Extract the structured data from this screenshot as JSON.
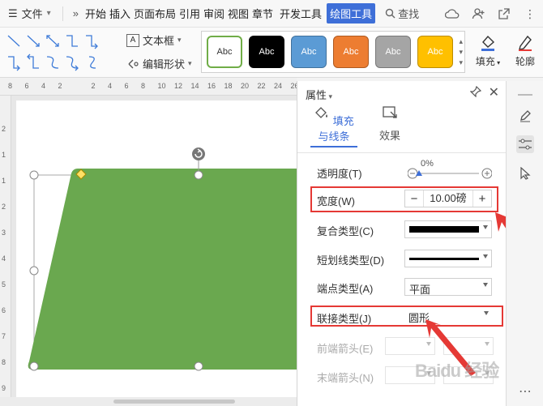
{
  "menubar": {
    "file_label": "文件",
    "tabs": [
      "开始",
      "插入",
      "页面布局",
      "引用",
      "审阅",
      "视图",
      "章节",
      "开发工具",
      "绘图工具"
    ],
    "active_tab": "绘图工具",
    "search_label": "查找"
  },
  "ribbon": {
    "textbox_label": "文本框",
    "edit_shape_label": "编辑形状",
    "style_chips": [
      {
        "label": "Abc",
        "bg": "#ffffff",
        "fg": "#333333",
        "border": "#70ad47"
      },
      {
        "label": "Abc",
        "bg": "#000000",
        "fg": "#ffffff",
        "border": "#000000"
      },
      {
        "label": "Abc",
        "bg": "#5b9bd5",
        "fg": "#ffffff",
        "border": "#41719c"
      },
      {
        "label": "Abc",
        "bg": "#ed7d31",
        "fg": "#ffffff",
        "border": "#ae5a21"
      },
      {
        "label": "Abc",
        "bg": "#a5a5a5",
        "fg": "#ffffff",
        "border": "#787878"
      },
      {
        "label": "Abc",
        "bg": "#ffc000",
        "fg": "#ffffff",
        "border": "#bc8c00"
      }
    ],
    "fill_label": "填充",
    "outline_label": "轮廓"
  },
  "rulers": {
    "h_ticks": [
      "8",
      "6",
      "4",
      "2",
      "",
      "2",
      "4",
      "6",
      "8",
      "10",
      "12",
      "14",
      "16",
      "18",
      "20",
      "22",
      "24",
      "26"
    ],
    "v_ticks": [
      "2",
      "1",
      "1",
      "2",
      "3",
      "4",
      "5",
      "6",
      "7",
      "8",
      "9"
    ]
  },
  "shape": {
    "fill": "#6aa84f"
  },
  "panel": {
    "title": "属性",
    "tabs": [
      "填充与线条",
      "效果"
    ],
    "active_tab": "填充与线条",
    "transparency_label": "透明度(T)",
    "transparency_value": "0%",
    "width_label": "宽度(W)",
    "width_value": "10.00磅",
    "compound_label": "复合类型(C)",
    "dash_label": "短划线类型(D)",
    "cap_label": "端点类型(A)",
    "cap_value": "平面",
    "join_label": "联接类型(J)",
    "join_value": "圆形",
    "begin_arrow_label": "前端箭头(E)",
    "end_arrow_label": "末端箭头(N)"
  },
  "watermark": "Baidu 经验",
  "colors": {
    "accent": "#3e6fd8",
    "highlight": "#e53935"
  }
}
